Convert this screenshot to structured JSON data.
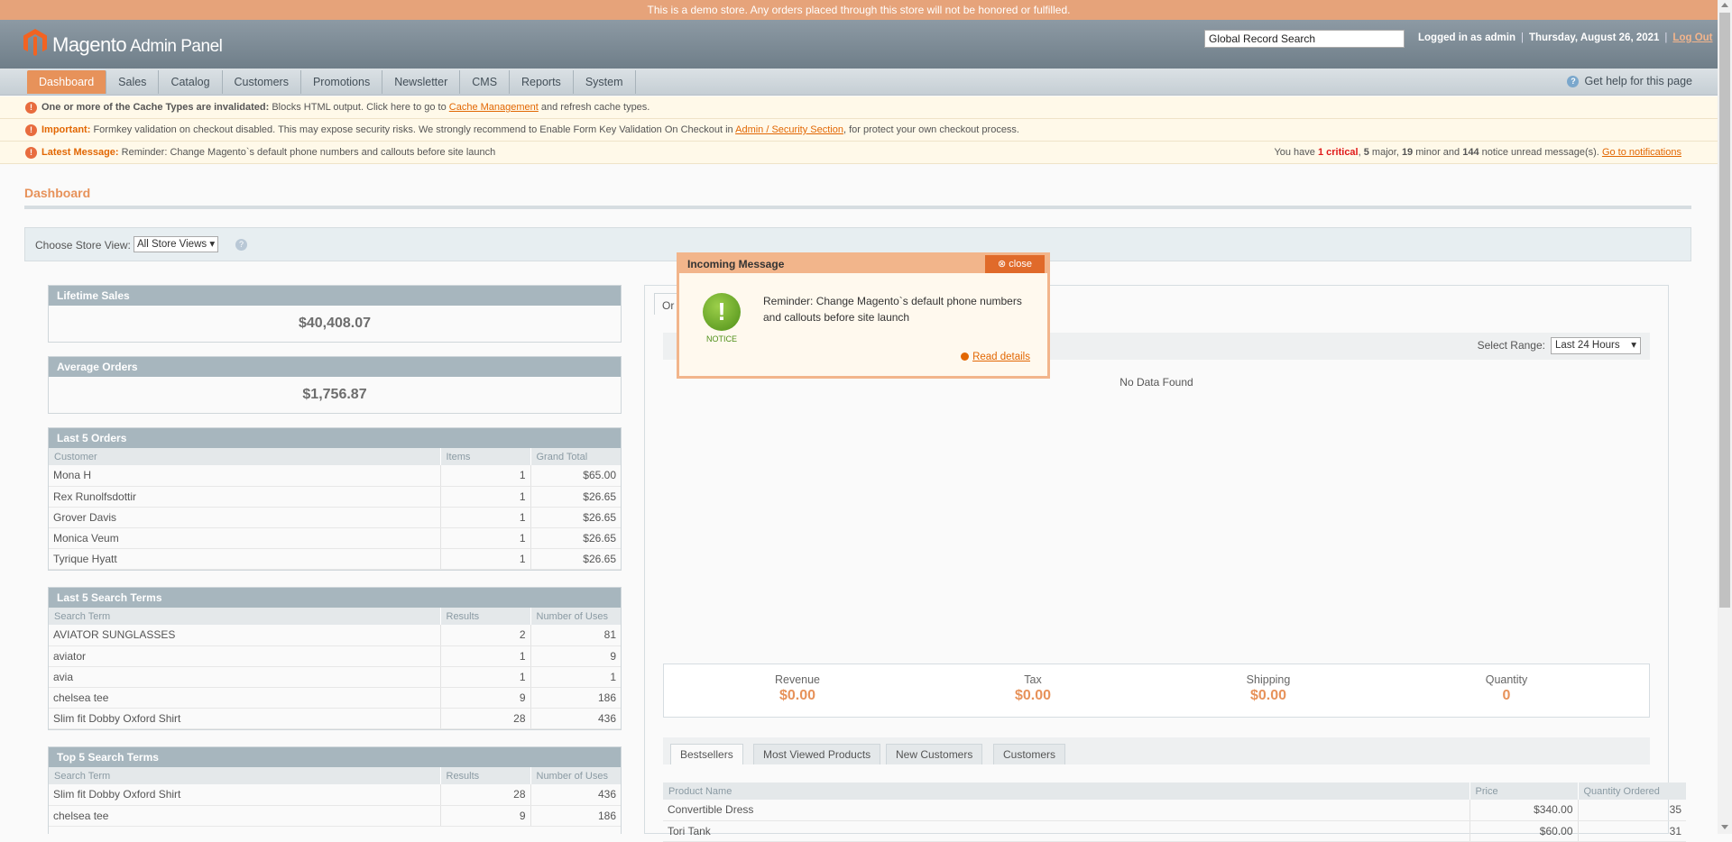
{
  "demo_notice": "This is a demo store. Any orders placed through this store will not be honored or fulfilled.",
  "header": {
    "brand": "Magento",
    "brand_sub": "Admin Panel",
    "search_placeholder": "Global Record Search",
    "logged_in": "Logged in as admin",
    "date": "Thursday, August 26, 2021",
    "logout": "Log Out"
  },
  "nav": {
    "items": [
      "Dashboard",
      "Sales",
      "Catalog",
      "Customers",
      "Promotions",
      "Newsletter",
      "CMS",
      "Reports",
      "System"
    ],
    "active": "Dashboard",
    "help": "Get help for this page"
  },
  "notices": {
    "cache_bold": "One or more of the Cache Types are invalidated:",
    "cache_text": " Blocks HTML output. Click here to go to ",
    "cache_link": "Cache Management",
    "cache_tail": " and refresh cache types.",
    "important_label": "Important:",
    "important_text": " Formkey validation on checkout disabled. This may expose security risks. We strongly recommend to Enable Form Key Validation On Checkout in ",
    "important_link": "Admin / Security Section",
    "important_tail": ", for protect your own checkout process.",
    "latest_label": "Latest Message:",
    "latest_text": " Reminder: Change Magento`s default phone numbers and callouts before site launch",
    "summary_prefix": "You have ",
    "critical_count": "1 critical",
    "major_count": "5",
    "minor_count": "19",
    "notice_count": "144",
    "summary_major": " major, ",
    "summary_minor": " minor and ",
    "summary_tail": " notice unread message(s). ",
    "notifications_link": "Go to notifications"
  },
  "page_title": "Dashboard",
  "store_switcher": {
    "label": "Choose Store View:",
    "value": "All Store Views"
  },
  "lifetime_sales": {
    "title": "Lifetime Sales",
    "value": "$40,408.07"
  },
  "average_orders": {
    "title": "Average Orders",
    "value": "$1,756.87"
  },
  "last_orders": {
    "title": "Last 5 Orders",
    "columns": [
      "Customer",
      "Items",
      "Grand Total"
    ],
    "rows": [
      [
        "Mona H",
        "1",
        "$65.00"
      ],
      [
        "Rex Runolfsdottir",
        "1",
        "$26.65"
      ],
      [
        "Grover Davis",
        "1",
        "$26.65"
      ],
      [
        "Monica Veum",
        "1",
        "$26.65"
      ],
      [
        "Tyrique Hyatt",
        "1",
        "$26.65"
      ]
    ]
  },
  "last_search": {
    "title": "Last 5 Search Terms",
    "columns": [
      "Search Term",
      "Results",
      "Number of Uses"
    ],
    "rows": [
      [
        "AVIATOR SUNGLASSES",
        "2",
        "81"
      ],
      [
        "aviator",
        "1",
        "9"
      ],
      [
        "avia",
        "1",
        "1"
      ],
      [
        "chelsea tee",
        "9",
        "186"
      ],
      [
        "Slim fit Dobby Oxford Shirt",
        "28",
        "436"
      ]
    ]
  },
  "top_search": {
    "title": "Top 5 Search Terms",
    "columns": [
      "Search Term",
      "Results",
      "Number of Uses"
    ],
    "rows": [
      [
        "Slim fit Dobby Oxford Shirt",
        "28",
        "436"
      ],
      [
        "chelsea tee",
        "9",
        "186"
      ]
    ]
  },
  "chart_panel": {
    "tab": "Or",
    "range_label": "Select Range:",
    "range_value": "Last 24 Hours",
    "no_data": "No Data Found"
  },
  "totals": [
    {
      "label": "Revenue",
      "value": "$0.00"
    },
    {
      "label": "Tax",
      "value": "$0.00"
    },
    {
      "label": "Shipping",
      "value": "$0.00"
    },
    {
      "label": "Quantity",
      "value": "0"
    }
  ],
  "product_tabs": [
    "Bestsellers",
    "Most Viewed Products",
    "New Customers",
    "Customers"
  ],
  "bestsellers": {
    "columns": [
      "Product Name",
      "Price",
      "Quantity Ordered"
    ],
    "rows": [
      [
        "Convertible Dress",
        "$340.00",
        "35"
      ],
      [
        "Tori Tank",
        "$60.00",
        "31"
      ]
    ]
  },
  "popup": {
    "title": "Incoming Message",
    "close": "close",
    "icon_label": "NOTICE",
    "message": "Reminder: Change Magento`s default phone numbers and callouts before site launch",
    "link": "Read details"
  },
  "colors": {
    "accent": "#e7925a",
    "header": "#7c8a95",
    "critical": "#e01a1a"
  }
}
